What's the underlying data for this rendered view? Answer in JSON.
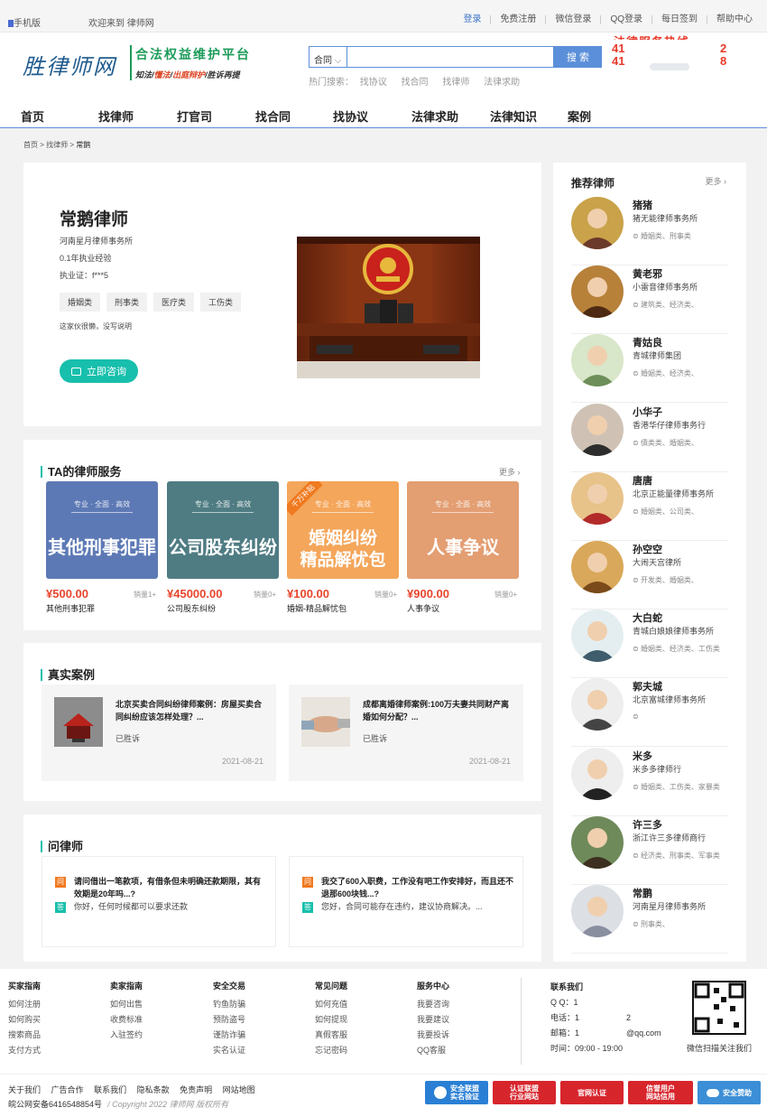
{
  "topbar": {
    "mobile": "手机版",
    "welcome": "欢迎来到 律师网",
    "links": [
      "登录",
      "免费注册",
      "微信登录",
      "QQ登录",
      "每日签到",
      "帮助中心"
    ]
  },
  "header": {
    "logo": "胜律师网",
    "slogan_main": "合法权益维护平台",
    "slogan_sub": [
      "知法",
      "懂法",
      "出庭辩护",
      "胜诉再提"
    ],
    "search_select": "合同",
    "search_placeholder": "",
    "search_button": "搜 索",
    "hot_label": "热门搜索：",
    "hot_items": [
      "找协议",
      "找合同",
      "找律师",
      "法律求助"
    ],
    "hotline_title": "法律服务热线",
    "hotline_parts": [
      "41",
      "2",
      "41",
      "8"
    ]
  },
  "nav": [
    "首页",
    "找律师",
    "打官司",
    "找合同",
    "找协议",
    "法律求助",
    "法律知识",
    "案例"
  ],
  "breadcrumb": [
    "首页",
    "找律师",
    "常鹅"
  ],
  "profile": {
    "name": "常鹅律师",
    "firm": "河南星月律师事务所",
    "experience": "0.1年执业经验",
    "license": "执业证：f***5",
    "tags": [
      "婚姻类",
      "刑事类",
      "医疗类",
      "工伤类"
    ],
    "bio": "这家伙很懒，没写说明",
    "consult_button": "立即咨询"
  },
  "services": {
    "title": "TA的律师服务",
    "more": "更多 ›",
    "items": [
      {
        "banner_top": "专业 · 全面 · 高效",
        "banner": "其他刑事犯罪",
        "price": "¥500.00",
        "sales": "销量1+",
        "name": "其他刑事犯罪",
        "color": "#5d79b5"
      },
      {
        "banner_top": "专业 · 全面 · 高效",
        "banner": "公司股东纠纷",
        "price": "¥45000.00",
        "sales": "销量0+",
        "name": "公司股东纠纷",
        "color": "#4f7c83"
      },
      {
        "banner_top": "专业 · 全面 · 高效",
        "banner": "婚姻纠纷\n精品解忧包",
        "price": "¥100.00",
        "sales": "销量0+",
        "name": "婚姻-精品解忧包",
        "color": "#f4a65b",
        "ribbon": "千万补贴"
      },
      {
        "banner_top": "专业 · 全面 · 高效",
        "banner": "人事争议",
        "price": "¥900.00",
        "sales": "销量0+",
        "name": "人事争议",
        "color": "#e39e72"
      }
    ]
  },
  "cases": {
    "title": "真实案例",
    "items": [
      {
        "title": "北京买卖合同纠纷律师案例：房屋买卖合同纠纷应该怎样处理？...",
        "status": "已胜诉",
        "date": "2021-08-21"
      },
      {
        "title": "成都离婚律师案例:100万夫妻共同财产离婚如何分配？...",
        "status": "已胜诉",
        "date": "2021-08-21"
      }
    ]
  },
  "qa": {
    "title": "问律师",
    "q_mark": "问",
    "a_mark": "答",
    "items": [
      {
        "q": "请问借出一笔款项，有借条但未明确还款期限，其有效期是20年吗...?",
        "a": "你好，任何时候都可以要求还款"
      },
      {
        "q": "我交了600入职费，工作没有吧工作安排好，而且还不退那600块钱...?",
        "a": "您好，合同可能存在违约，建议协商解决。..."
      }
    ]
  },
  "sidebar": {
    "title": "推荐律师",
    "more": "更多 ›",
    "lawyers": [
      {
        "name": "猪猪",
        "firm": "猪无能律师事务所",
        "tags": "婚姻类、刑事类"
      },
      {
        "name": "黄老邪",
        "firm": "小雷音律师事务所",
        "tags": "建筑类、经济类、"
      },
      {
        "name": "青姑良",
        "firm": "青城律师集团",
        "tags": "婚姻类、经济类、"
      },
      {
        "name": "小华子",
        "firm": "香港华仔律师事务行",
        "tags": "債类类、婚姻类、"
      },
      {
        "name": "唐唐",
        "firm": "北京正能量律师事务所",
        "tags": "婚姻类、公司类、"
      },
      {
        "name": "孙空空",
        "firm": "大闹天宫律所",
        "tags": "开发类、婚姻类、"
      },
      {
        "name": "大白蛇",
        "firm": "青城白娘娘律师事务所",
        "tags": "婚姻类、经济类、工伤类"
      },
      {
        "name": "郭夫城",
        "firm": "北京富城律师事务所",
        "tags": ""
      },
      {
        "name": "米多",
        "firm": "米多多律师行",
        "tags": "婚姻类、工伤类、家暴类"
      },
      {
        "name": "许三多",
        "firm": "浙江许三多律师商行",
        "tags": "经济类、刑事类、军事类"
      },
      {
        "name": "常鹏",
        "firm": "河南星月律师事务所",
        "tags": "刑事类、"
      }
    ]
  },
  "footer": {
    "cols": [
      {
        "title": "买家指南",
        "items": [
          "如何注册",
          "如何购买",
          "搜索商品",
          "支付方式"
        ]
      },
      {
        "title": "卖家指南",
        "items": [
          "如何出售",
          "收费标准",
          "入驻签约"
        ]
      },
      {
        "title": "安全交易",
        "items": [
          "钓鱼防骗",
          "预防盗号",
          "谨防诈骗",
          "实名认证"
        ]
      },
      {
        "title": "常见问题",
        "items": [
          "如何充值",
          "如何提现",
          "真假客服",
          "忘记密码"
        ]
      },
      {
        "title": "服务中心",
        "items": [
          "我要咨询",
          "我要建议",
          "我要投诉",
          "QQ客服"
        ]
      }
    ],
    "contact_title": "联系我们",
    "contact": {
      "qq": "Q Q：1",
      "phone": "电话：1",
      "phone_tail": "2",
      "email": "邮箱：1",
      "email_tail": "@qq.com",
      "hours": "时间：09:00 - 19:00"
    },
    "qr_text": "微信扫描关注我们",
    "links": [
      "关于我们",
      "广告合作",
      "联系我们",
      "隐私条款",
      "免责声明",
      "网站地图"
    ],
    "icp": "皖公网安备6416548854号",
    "copyright": "/  Copyright 2022 律师网 版权所有",
    "badges": [
      {
        "text": "安全联盟\n实名验证",
        "color": "#2a7fd4"
      },
      {
        "text": "认证联盟\n行业网站",
        "color": "#d7252c"
      },
      {
        "text": "官网认证",
        "color": "#d7252c"
      },
      {
        "text": "信誉用户\n网站信用",
        "color": "#d7252c"
      },
      {
        "text": "安全赞助",
        "color": "#3c8fd6"
      }
    ]
  }
}
